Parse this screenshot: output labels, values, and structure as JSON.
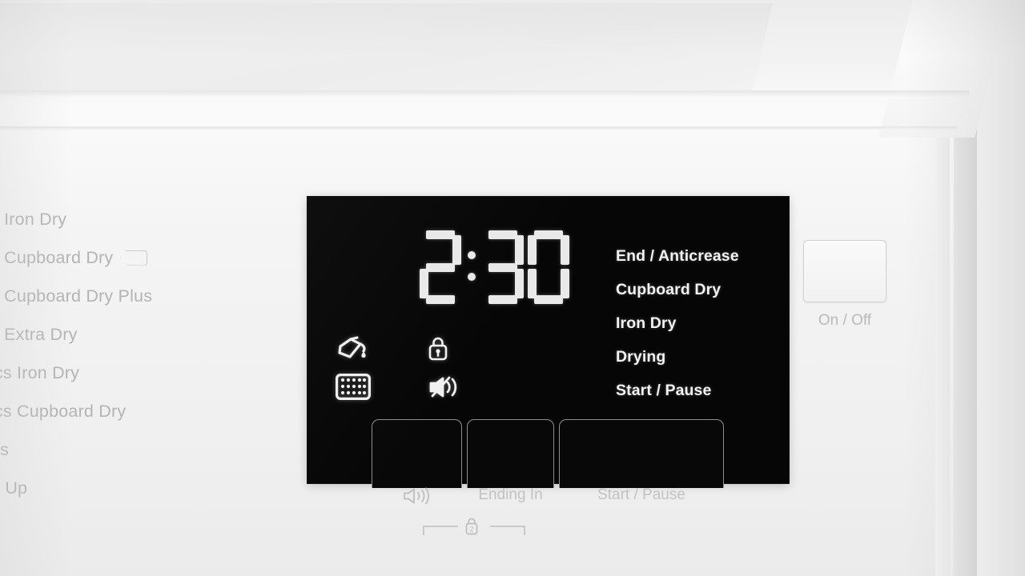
{
  "appliance": {
    "type": "tumble-dryer-control-panel",
    "body_color": "#f2f2f2",
    "panel_color": "#060606",
    "display_text_color": "#e9e9e9",
    "silkscreen_color": "#bdbdbd"
  },
  "program_list": {
    "items": [
      {
        "label": "s Iron Dry",
        "tag": false
      },
      {
        "label": "s Cupboard Dry",
        "tag": true
      },
      {
        "label": "s Cupboard Dry Plus",
        "tag": false
      },
      {
        "label": "s Extra Dry",
        "tag": false
      },
      {
        "label": "ics Iron Dry",
        "tag": false
      },
      {
        "label": "ics Cupboard Dry",
        "tag": false
      },
      {
        "label": "es",
        "tag": false
      },
      {
        "label": "n Up",
        "tag": false
      }
    ]
  },
  "display": {
    "time_remaining": "2:30",
    "hours": "2",
    "minutes": "30",
    "status_indicators": [
      {
        "name": "water-container-icon",
        "label": "Empty Water Container",
        "active": true
      },
      {
        "name": "child-lock-icon",
        "label": "Child Lock",
        "active": true
      },
      {
        "name": "filter-icon",
        "label": "Clean Filter",
        "active": true
      },
      {
        "name": "mute-icon",
        "label": "Buzzer Off",
        "active": true
      }
    ],
    "status_labels": [
      "End / Anticrease",
      "Cupboard Dry",
      "Iron Dry",
      "Drying",
      "Start / Pause"
    ]
  },
  "touch_buttons": [
    {
      "name": "buzzer-button",
      "label": "speaker-icon"
    },
    {
      "name": "ending-in-button",
      "label": "Ending In"
    },
    {
      "name": "start-pause-button",
      "label": "Start / Pause"
    }
  ],
  "child_lock_hint": {
    "icon": "padlock-icon",
    "digit": "2"
  },
  "power": {
    "label": "On / Off"
  }
}
